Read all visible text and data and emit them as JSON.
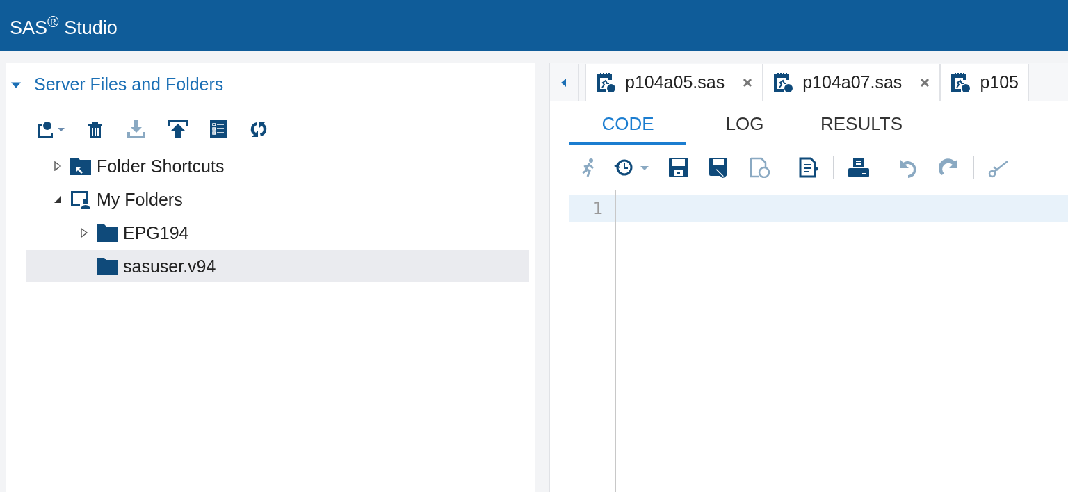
{
  "window": {
    "title": "SAS$^{®}$ Studio"
  },
  "sidebar": {
    "section": {
      "title": "Server Files and Folders",
      "expanded": true
    },
    "toolbar": [
      {
        "kind": "new",
        "disabled": false
      },
      {
        "kind": "delete",
        "disabled": false
      },
      {
        "kind": "download",
        "disabled": true
      },
      {
        "kind": "upload",
        "disabled": false
      },
      {
        "kind": "properties",
        "disabled": false
      },
      {
        "kind": "refresh",
        "disabled": false
      }
    ],
    "tree": [
      {
        "label": "Folder Shortcuts",
        "kind": "shortcut",
        "expanded": false,
        "selected": false
      },
      {
        "label": "My Folders",
        "kind": "home",
        "expanded": true,
        "selected": false,
        "children": [
          {
            "label": "EPG194",
            "kind": "folder",
            "expanded": false,
            "selected": false
          },
          {
            "label": "sasuser.v94",
            "kind": "folder",
            "selected": true
          }
        ]
      }
    ]
  },
  "file_tabs": [
    {
      "label": "p104a05.sas",
      "closable": true
    },
    {
      "label": "p104a07.sas",
      "closable": true
    },
    {
      "label": "p105",
      "closable": false
    }
  ],
  "view_tabs": [
    {
      "label": "CODE",
      "selected": true
    },
    {
      "label": "LOG",
      "selected": false
    },
    {
      "label": "RESULTS",
      "selected": false
    }
  ],
  "editor_toolbar": [
    {
      "kind": "run",
      "disabled": true
    },
    {
      "kind": "history",
      "disabled": false
    },
    {
      "kind": "save",
      "disabled": false
    },
    {
      "kind": "save-as",
      "disabled": false
    },
    {
      "kind": "email",
      "disabled": true
    },
    {
      "kind": "separator"
    },
    {
      "kind": "format",
      "disabled": false
    },
    {
      "kind": "separator"
    },
    {
      "kind": "print",
      "disabled": false
    },
    {
      "kind": "separator"
    },
    {
      "kind": "undo",
      "disabled": true
    },
    {
      "kind": "redo",
      "disabled": true
    },
    {
      "kind": "separator"
    },
    {
      "kind": "cut",
      "disabled": true
    }
  ],
  "editor": {
    "lines": [
      "1"
    ]
  }
}
